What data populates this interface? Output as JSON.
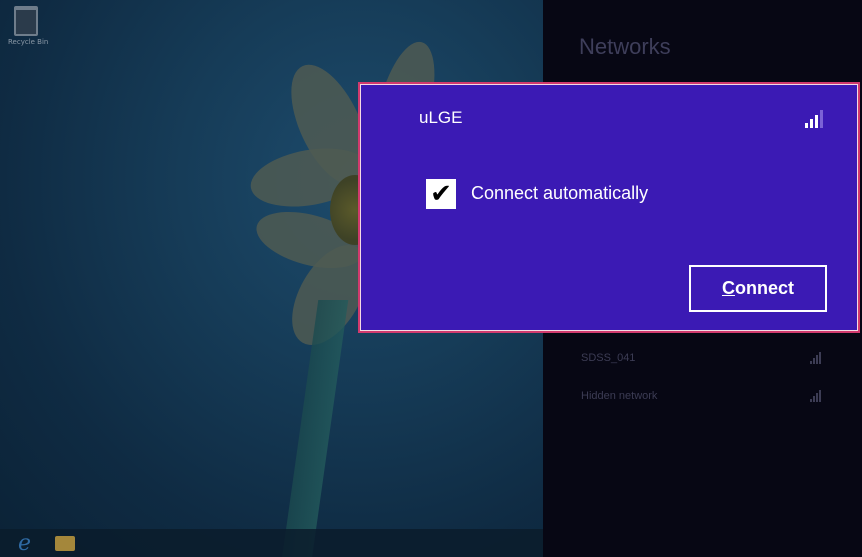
{
  "desktop": {
    "recycle_bin_label": "Recycle Bin"
  },
  "networks_panel": {
    "title": "Networks",
    "selected_network": {
      "name": "uLGE",
      "signal_icon": "wifi-signal-icon",
      "auto_connect_label": "Connect automatically",
      "auto_connect_checked": true,
      "connect_button": {
        "accesskey_letter": "C",
        "rest": "onnect"
      }
    },
    "other_networks": [
      {
        "name": "SDSS_041"
      },
      {
        "name": "Hidden network"
      }
    ]
  },
  "colors": {
    "card_background": "#3b1ab4",
    "card_border": "#d13a6e",
    "panel_background": "#070714"
  }
}
